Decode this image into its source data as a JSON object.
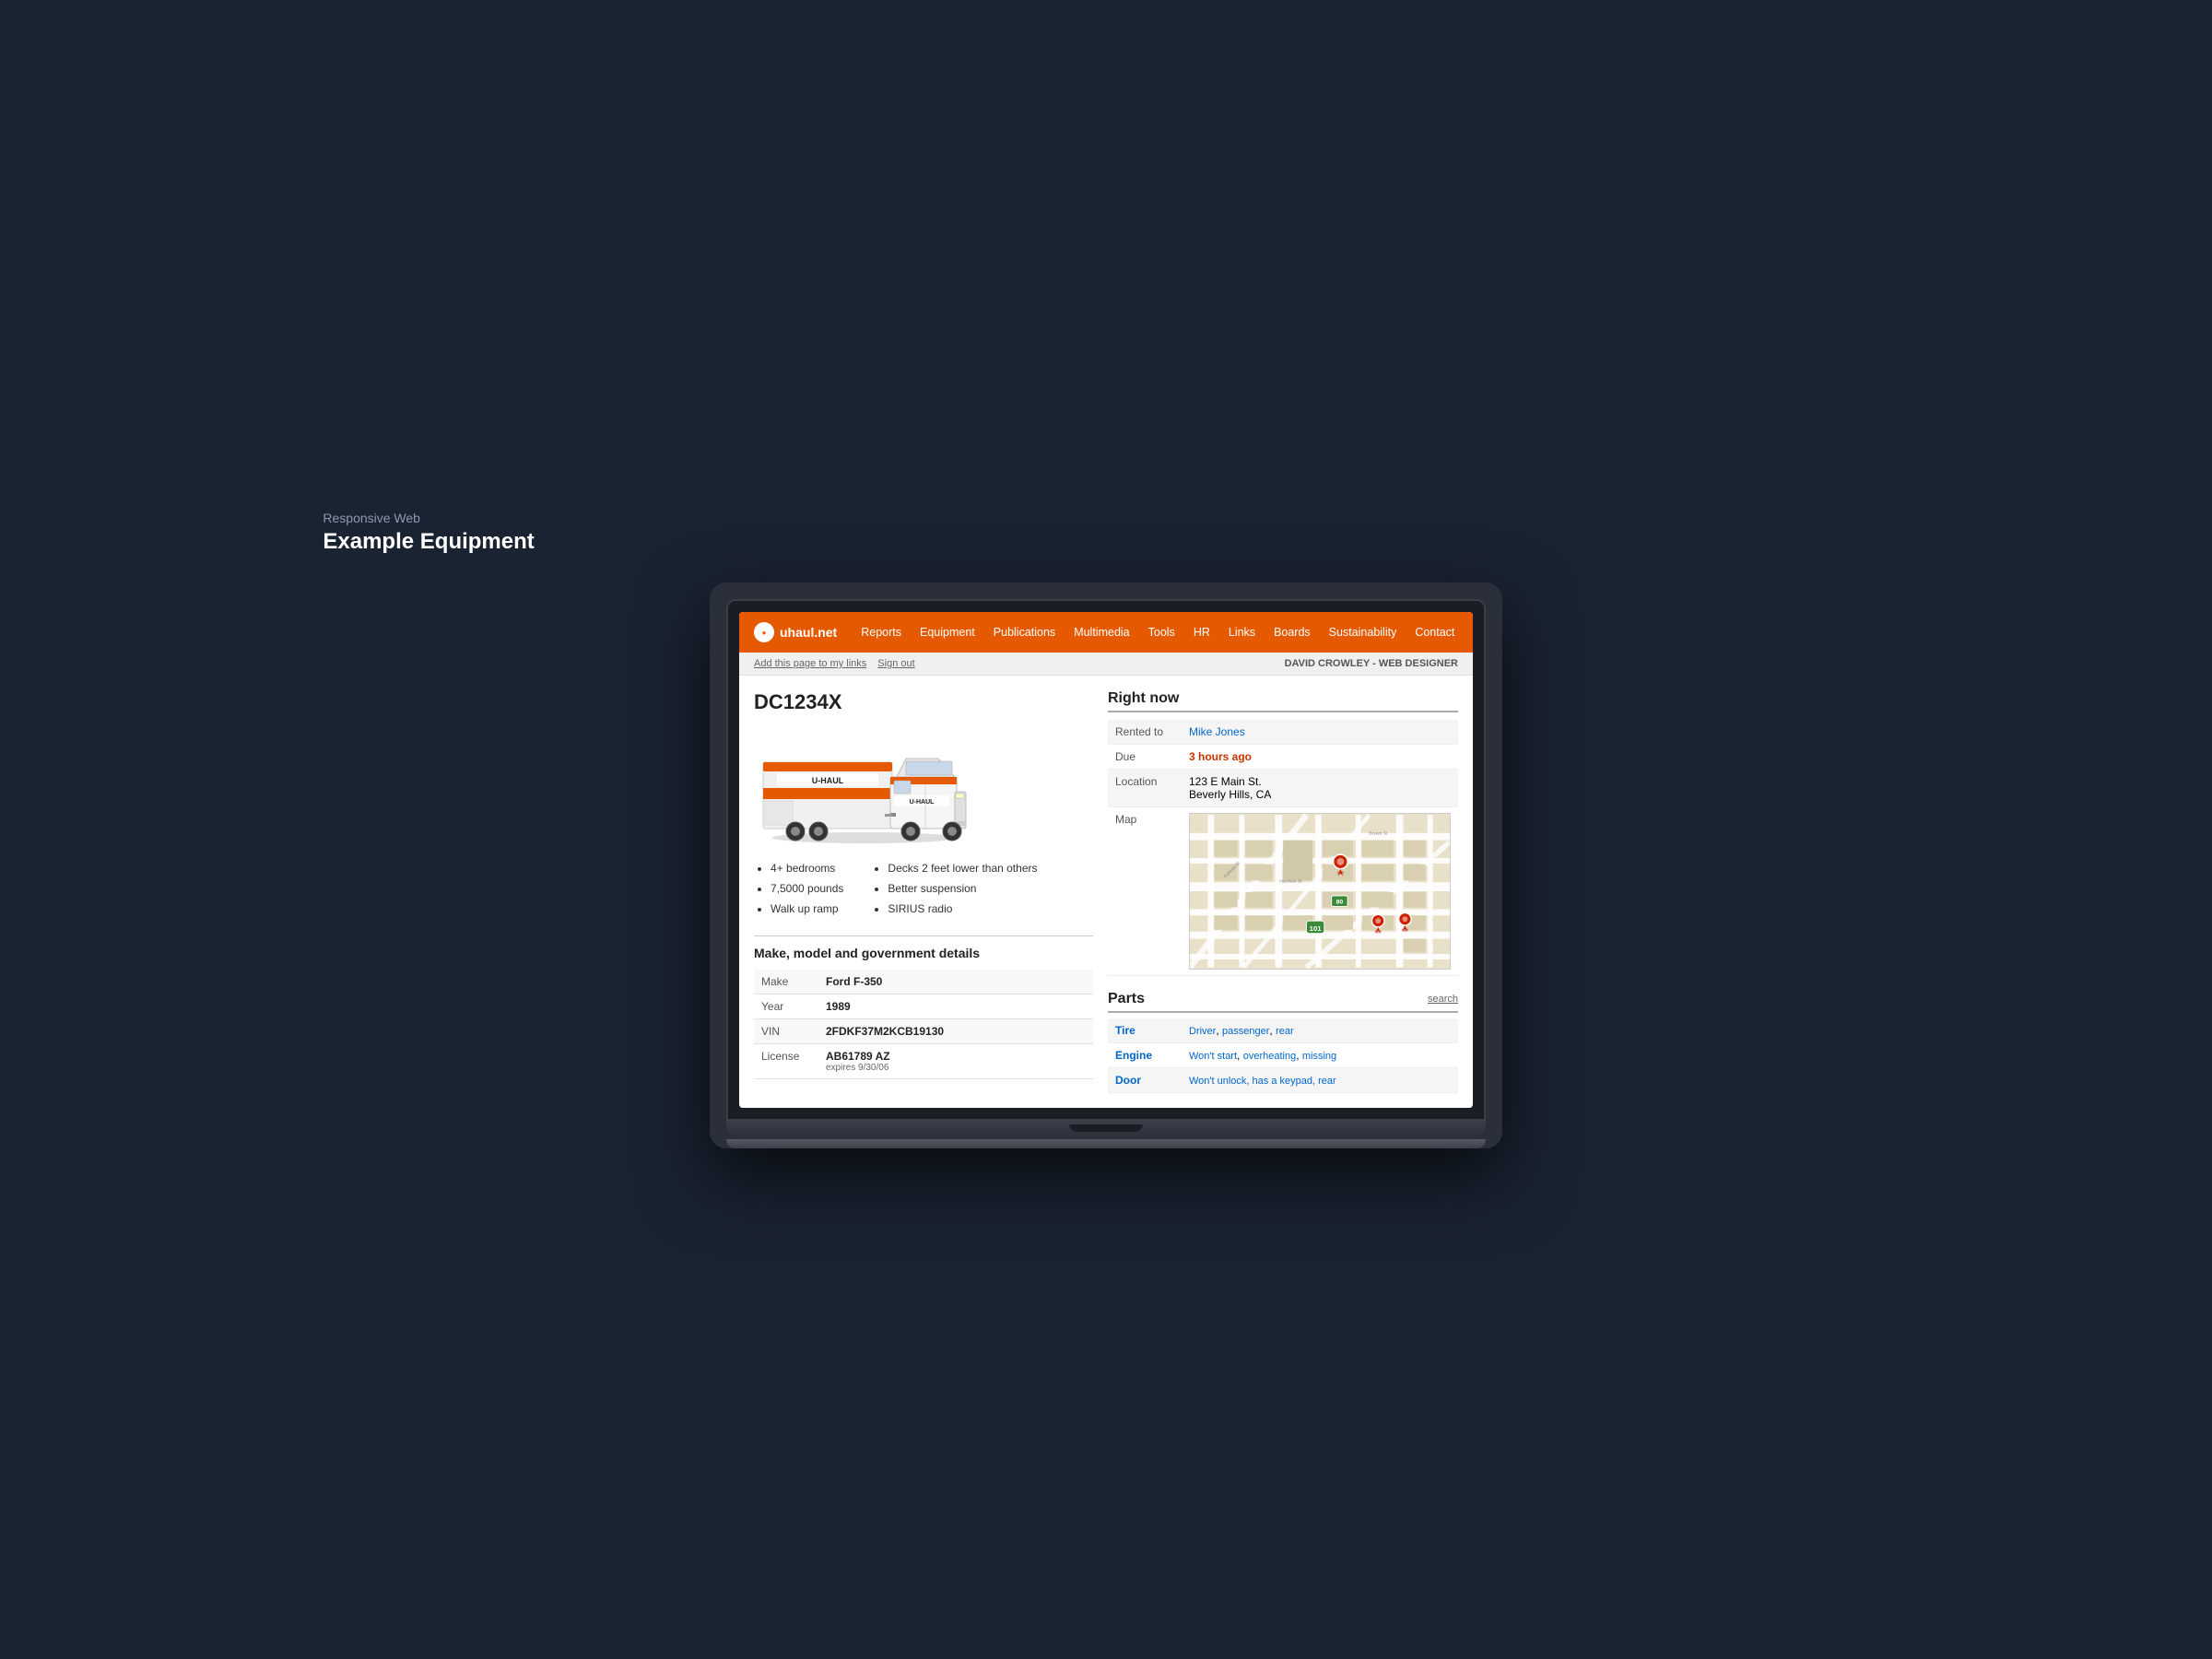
{
  "page": {
    "label": "Responsive Web",
    "title": "Example Equipment"
  },
  "nav": {
    "logo_circle": "U",
    "logo_text": "uhaul.net",
    "items": [
      {
        "label": "Reports"
      },
      {
        "label": "Equipment"
      },
      {
        "label": "Publications"
      },
      {
        "label": "Multimedia"
      },
      {
        "label": "Tools"
      },
      {
        "label": "HR"
      },
      {
        "label": "Links"
      },
      {
        "label": "Boards"
      },
      {
        "label": "Sustainability"
      },
      {
        "label": "Contact"
      }
    ]
  },
  "subnav": {
    "link1": "Add this page to my links",
    "link2": "Sign out",
    "user": "DAVID CROWLEY - WEB DESIGNER"
  },
  "equipment": {
    "id": "DC1234X",
    "features_left": [
      "4+ bedrooms",
      "7,5000 pounds",
      "Walk up ramp"
    ],
    "features_right": [
      "Decks 2 feet lower than others",
      "Better suspension",
      "SIRIUS radio"
    ],
    "make_model_title": "Make, model and government details",
    "details": [
      {
        "label": "Make",
        "value": "Ford F-350",
        "sub": ""
      },
      {
        "label": "Year",
        "value": "1989",
        "sub": ""
      },
      {
        "label": "VIN",
        "value": "2FDKF37M2KCB19130",
        "sub": ""
      },
      {
        "label": "License",
        "value": "AB61789 AZ",
        "sub": "expires 9/30/06"
      }
    ]
  },
  "right_now": {
    "title": "Right now",
    "rows": [
      {
        "label": "Rented to",
        "value": "Mike Jones",
        "type": "link"
      },
      {
        "label": "Due",
        "value": "3 hours ago",
        "type": "overdue"
      },
      {
        "label": "Location",
        "value": "123 E Main St.\nBeverly Hills, CA",
        "type": "text"
      },
      {
        "label": "Map",
        "value": "",
        "type": "map"
      }
    ]
  },
  "parts": {
    "title": "Parts",
    "search_label": "search",
    "items": [
      {
        "part": "Tire",
        "issues": [
          "Driver",
          "passenger",
          "rear"
        ]
      },
      {
        "part": "Engine",
        "issues": [
          "Won't start",
          "overheating",
          "missing"
        ]
      },
      {
        "part": "Door",
        "issues": [
          "Won't unlock, has a keypad, rear"
        ]
      }
    ]
  },
  "colors": {
    "nav_orange": "#e55a00",
    "link_blue": "#0066cc",
    "overdue_red": "#cc3300",
    "bg_light": "#f5f5f5"
  }
}
